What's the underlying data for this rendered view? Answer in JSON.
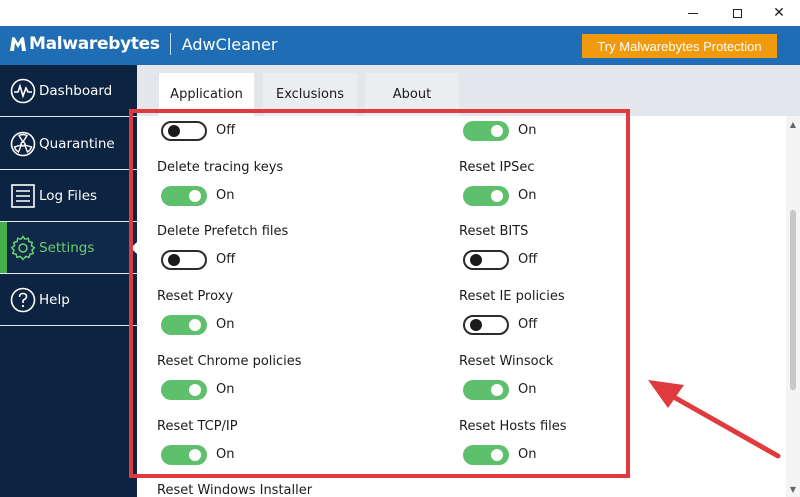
{
  "window": {
    "minimize_icon": "minimize-icon",
    "maximize_icon": "maximize-icon",
    "close_glyph": "✕"
  },
  "header": {
    "brand": "Malwarebytes",
    "product": "AdwCleaner",
    "cta_label": "Try Malwarebytes Protection"
  },
  "sidebar": {
    "items": [
      {
        "label": "Dashboard",
        "icon": "pulse-icon"
      },
      {
        "label": "Quarantine",
        "icon": "radiation-icon"
      },
      {
        "label": "Log Files",
        "icon": "document-icon"
      },
      {
        "label": "Settings",
        "icon": "gear-icon"
      },
      {
        "label": "Help",
        "icon": "question-icon"
      }
    ],
    "active": "Settings"
  },
  "tabs": [
    {
      "label": "Application",
      "active": true
    },
    {
      "label": "Exclusions",
      "active": false
    },
    {
      "label": "About",
      "active": false
    }
  ],
  "options": {
    "left": [
      {
        "label": "",
        "state": "Off"
      },
      {
        "label": "Delete tracing keys",
        "state": "On"
      },
      {
        "label": "Delete Prefetch files",
        "state": "Off"
      },
      {
        "label": "Reset Proxy",
        "state": "On"
      },
      {
        "label": "Reset Chrome policies",
        "state": "On"
      },
      {
        "label": "Reset TCP/IP",
        "state": "On"
      },
      {
        "label": "Reset Windows Installer",
        "state": ""
      }
    ],
    "right": [
      {
        "label": "",
        "state": "On"
      },
      {
        "label": "Reset IPSec",
        "state": "On"
      },
      {
        "label": "Reset BITS",
        "state": "Off"
      },
      {
        "label": "Reset IE policies",
        "state": "Off"
      },
      {
        "label": "Reset Winsock",
        "state": "On"
      },
      {
        "label": "Reset Hosts files",
        "state": "On"
      }
    ]
  },
  "colors": {
    "header_blue": "#1f6db4",
    "cta_orange": "#f29a0d",
    "sidebar_navy": "#0c2341",
    "active_green": "#43b049",
    "toggle_on": "#5ebf6c",
    "annotation_red": "#e03a3e"
  }
}
